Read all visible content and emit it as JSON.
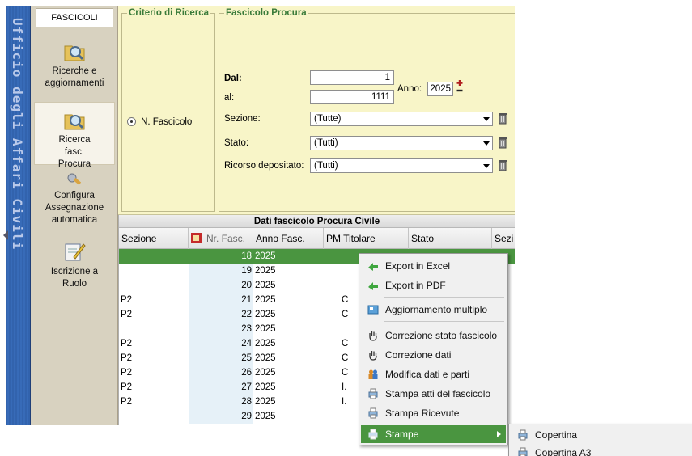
{
  "banner": {
    "text": "Ufficio degli Affari Civili"
  },
  "sidebar": {
    "tab": "FASCICOLI",
    "items": [
      {
        "label": "Ricerche e aggiornamenti",
        "icon": "search-folder-icon"
      },
      {
        "label": "Ricerca fasc. Procura",
        "icon": "search-folder-icon"
      },
      {
        "label": "Configura Assegnazione automatica",
        "icon": "config-icon"
      },
      {
        "label": "Iscrizione a Ruolo",
        "icon": "edit-document-icon"
      }
    ]
  },
  "criteria": {
    "legend": "Criterio di Ricerca",
    "option_label": "N. Fascicolo",
    "procura": {
      "legend": "Fascicolo Procura",
      "dal_label": "Dal:",
      "dal_value": "1",
      "al_label": "al:",
      "al_value": "1111",
      "anno_label": "Anno:",
      "anno_value": "2025",
      "sezione_label": "Sezione:",
      "sezione_value": "(Tutte)",
      "stato_label": "Stato:",
      "stato_value": "(Tutti)",
      "ricorso_label": "Ricorso depositato:",
      "ricorso_value": "(Tutti)"
    }
  },
  "grid": {
    "title": "Dati fascicolo Procura Civile",
    "columns": [
      "Sezione",
      "Nr. Fasc.",
      "Anno Fasc.",
      "PM Titolare",
      "Stato",
      "Sezi"
    ],
    "rows": [
      {
        "sezione": "",
        "nr": "18",
        "anno": "2025",
        "pm": "",
        "selected": true
      },
      {
        "sezione": "",
        "nr": "19",
        "anno": "2025",
        "pm": ""
      },
      {
        "sezione": "",
        "nr": "20",
        "anno": "2025",
        "pm": ""
      },
      {
        "sezione": "P2",
        "nr": "21",
        "anno": "2025",
        "pm": "C"
      },
      {
        "sezione": "P2",
        "nr": "22",
        "anno": "2025",
        "pm": "C"
      },
      {
        "sezione": "",
        "nr": "23",
        "anno": "2025",
        "pm": ""
      },
      {
        "sezione": "P2",
        "nr": "24",
        "anno": "2025",
        "pm": "C"
      },
      {
        "sezione": "P2",
        "nr": "25",
        "anno": "2025",
        "pm": "C"
      },
      {
        "sezione": "P2",
        "nr": "26",
        "anno": "2025",
        "pm": "C"
      },
      {
        "sezione": "P2",
        "nr": "27",
        "anno": "2025",
        "pm": "I."
      },
      {
        "sezione": "P2",
        "nr": "28",
        "anno": "2025",
        "pm": "I."
      },
      {
        "sezione": "",
        "nr": "29",
        "anno": "2025",
        "pm": ""
      }
    ]
  },
  "context_menu": {
    "items": [
      {
        "label": "Export in Excel",
        "icon": "excel-export-icon"
      },
      {
        "label": "Export in PDF",
        "icon": "pdf-export-icon"
      },
      {
        "label": "Aggiornamento multiplo",
        "icon": "multi-update-icon"
      },
      {
        "label": "Correzione stato fascicolo",
        "icon": "hand-icon"
      },
      {
        "label": "Correzione dati",
        "icon": "hand-icon"
      },
      {
        "label": "Modifica dati e parti",
        "icon": "people-icon"
      },
      {
        "label": "Stampa atti del fascicolo",
        "icon": "print-icon"
      },
      {
        "label": "Stampa Ricevute",
        "icon": "print-icon"
      },
      {
        "label": "Stampe",
        "icon": "print-icon",
        "highlighted": true
      }
    ],
    "submenu": [
      {
        "label": "Copertina",
        "icon": "print-icon"
      },
      {
        "label": "Copertina A3",
        "icon": "print-icon"
      }
    ]
  },
  "colors": {
    "highlight": "#4a9540",
    "criteria_bg": "#f8f5c8",
    "legend": "#3a7b3a",
    "banner": "#2f5fa8"
  }
}
